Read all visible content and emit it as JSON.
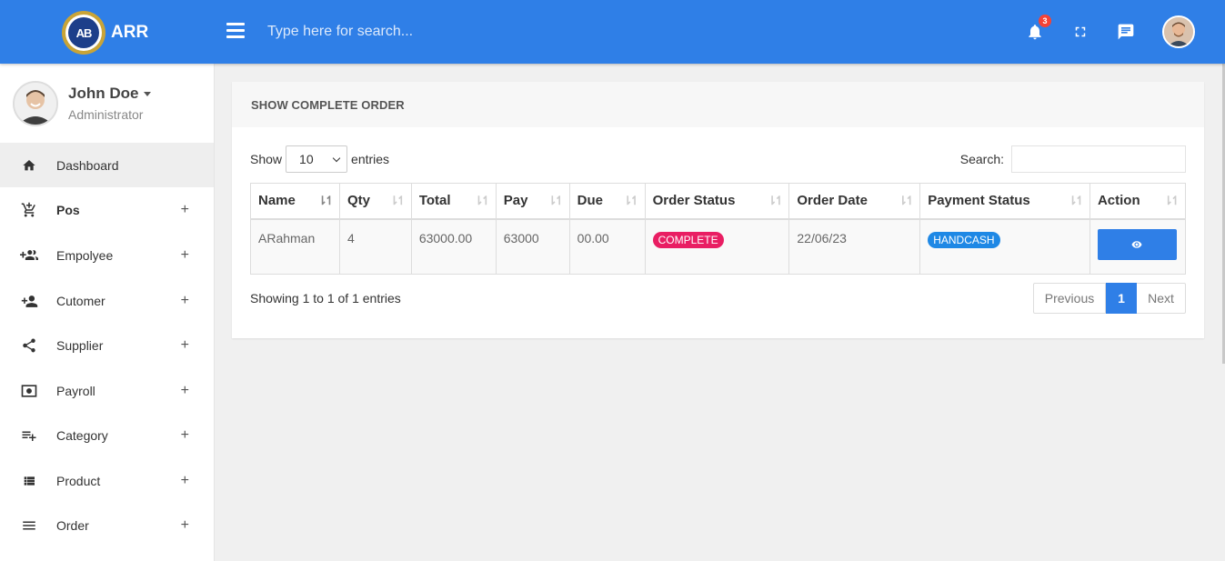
{
  "header": {
    "brand": "ARR",
    "logo_text": "AB",
    "search_placeholder": "Type here for search...",
    "notification_count": "3",
    "icons": [
      "bell-icon",
      "fullscreen-icon",
      "chat-icon"
    ]
  },
  "user": {
    "name": "John Doe",
    "role": "Administrator"
  },
  "sidebar": {
    "items": [
      {
        "label": "Dashboard",
        "icon": "home-icon",
        "active": true
      },
      {
        "label": "Pos",
        "icon": "cart-add-icon",
        "expandable": true
      },
      {
        "label": "Empolyee",
        "icon": "group-add-icon",
        "expandable": true
      },
      {
        "label": "Cutomer",
        "icon": "person-add-icon",
        "expandable": true
      },
      {
        "label": "Supplier",
        "icon": "share-icon",
        "expandable": true
      },
      {
        "label": "Payroll",
        "icon": "money-icon",
        "expandable": true
      },
      {
        "label": "Category",
        "icon": "playlist-add-icon",
        "expandable": true
      },
      {
        "label": "Product",
        "icon": "list-view-icon",
        "expandable": true
      },
      {
        "label": "Order",
        "icon": "menu-lines-icon",
        "expandable": true
      }
    ],
    "expand_symbol": "+"
  },
  "card": {
    "title": "SHOW COMPLETE ORDER",
    "show_label": "Show",
    "entries_value": "10",
    "entries_label": "entries",
    "search_label": "Search:",
    "columns": [
      "Name",
      "Qty",
      "Total",
      "Pay",
      "Due",
      "Order Status",
      "Order Date",
      "Payment Status",
      "Action"
    ],
    "rows": [
      {
        "name": "ARahman",
        "qty": "4",
        "total": "63000.00",
        "pay": "63000",
        "due": "00.00",
        "order_status": "COMPLETE",
        "order_date": "22/06/23",
        "payment_status": "HANDCASH"
      }
    ],
    "info": "Showing 1 to 1 of 1 entries",
    "pagination": {
      "previous": "Previous",
      "current": "1",
      "next": "Next"
    }
  },
  "colors": {
    "primary": "#2f7fe7",
    "complete_badge": "#e91e63",
    "payment_badge": "#1e88e5",
    "notification_badge": "#f44336"
  }
}
